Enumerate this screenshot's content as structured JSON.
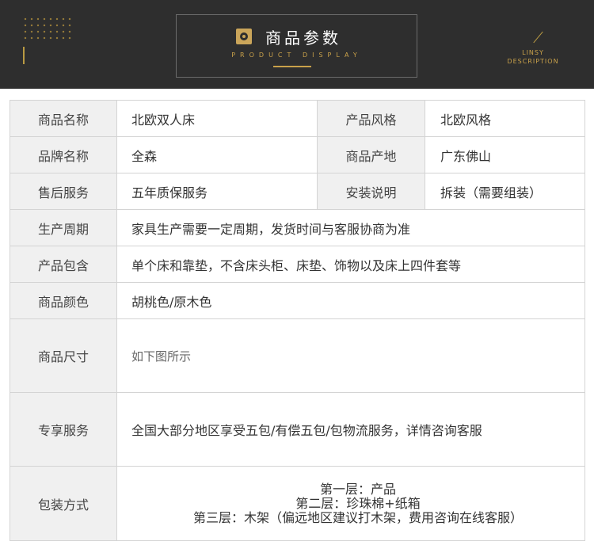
{
  "header": {
    "title_cn": "商品参数",
    "title_en": "PRODUCT DISPLAY",
    "brand_line1": "LINSY",
    "brand_line2": "DESCRIPTION"
  },
  "params": {
    "name_label": "商品名称",
    "name_value": "北欧双人床",
    "style_label": "产品风格",
    "style_value": "北欧风格",
    "brand_label": "品牌名称",
    "brand_value": "全森",
    "origin_label": "商品产地",
    "origin_value": "广东佛山",
    "service_label": "售后服务",
    "service_value": "五年质保服务",
    "install_label": "安装说明",
    "install_value": "拆装（需要组装）",
    "cycle_label": "生产周期",
    "cycle_value": "家具生产需要一定周期，发货时间与客服协商为准",
    "include_label": "产品包含",
    "include_value": "单个床和靠垫，不含床头柜、床垫、饰物以及床上四件套等",
    "color_label": "商品颜色",
    "color_value": "胡桃色/原木色",
    "size_label": "商品尺寸",
    "size_value": "如下图所示",
    "exclusive_label": "专享服务",
    "exclusive_value": "全国大部分地区享受五包/有偿五包/包物流服务，详情咨询客服",
    "pack_label": "包装方式",
    "pack_lines": [
      "第一层：产品",
      "第二层：珍珠棉+纸箱",
      "第三层：木架（偏远地区建议打木架，费用咨询在线客服）"
    ]
  }
}
